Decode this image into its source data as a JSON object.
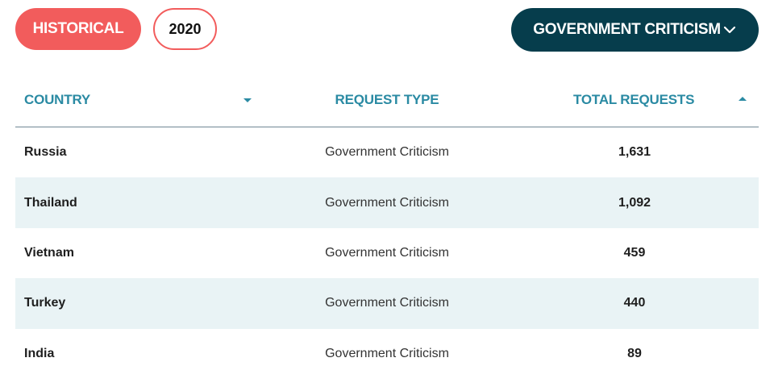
{
  "controls": {
    "historical_label": "HISTORICAL",
    "year_label": "2020",
    "filter_label": "GOVERNMENT CRITICISM",
    "filter_icon": "chevron-down-icon"
  },
  "table": {
    "headers": {
      "country": "COUNTRY",
      "request_type": "REQUEST TYPE",
      "total_requests": "TOTAL REQUESTS"
    },
    "rows": [
      {
        "country": "Russia",
        "request_type": "Government Criticism",
        "total": "1,631"
      },
      {
        "country": "Thailand",
        "request_type": "Government Criticism",
        "total": "1,092"
      },
      {
        "country": "Vietnam",
        "request_type": "Government Criticism",
        "total": "459"
      },
      {
        "country": "Turkey",
        "request_type": "Government Criticism",
        "total": "440"
      },
      {
        "country": "India",
        "request_type": "Government Criticism",
        "total": "89"
      }
    ]
  },
  "colors": {
    "accent_red": "#f25c5c",
    "dark_teal": "#063d4c",
    "header_teal": "#2a8aa3",
    "row_alt": "#e9f3f5"
  }
}
